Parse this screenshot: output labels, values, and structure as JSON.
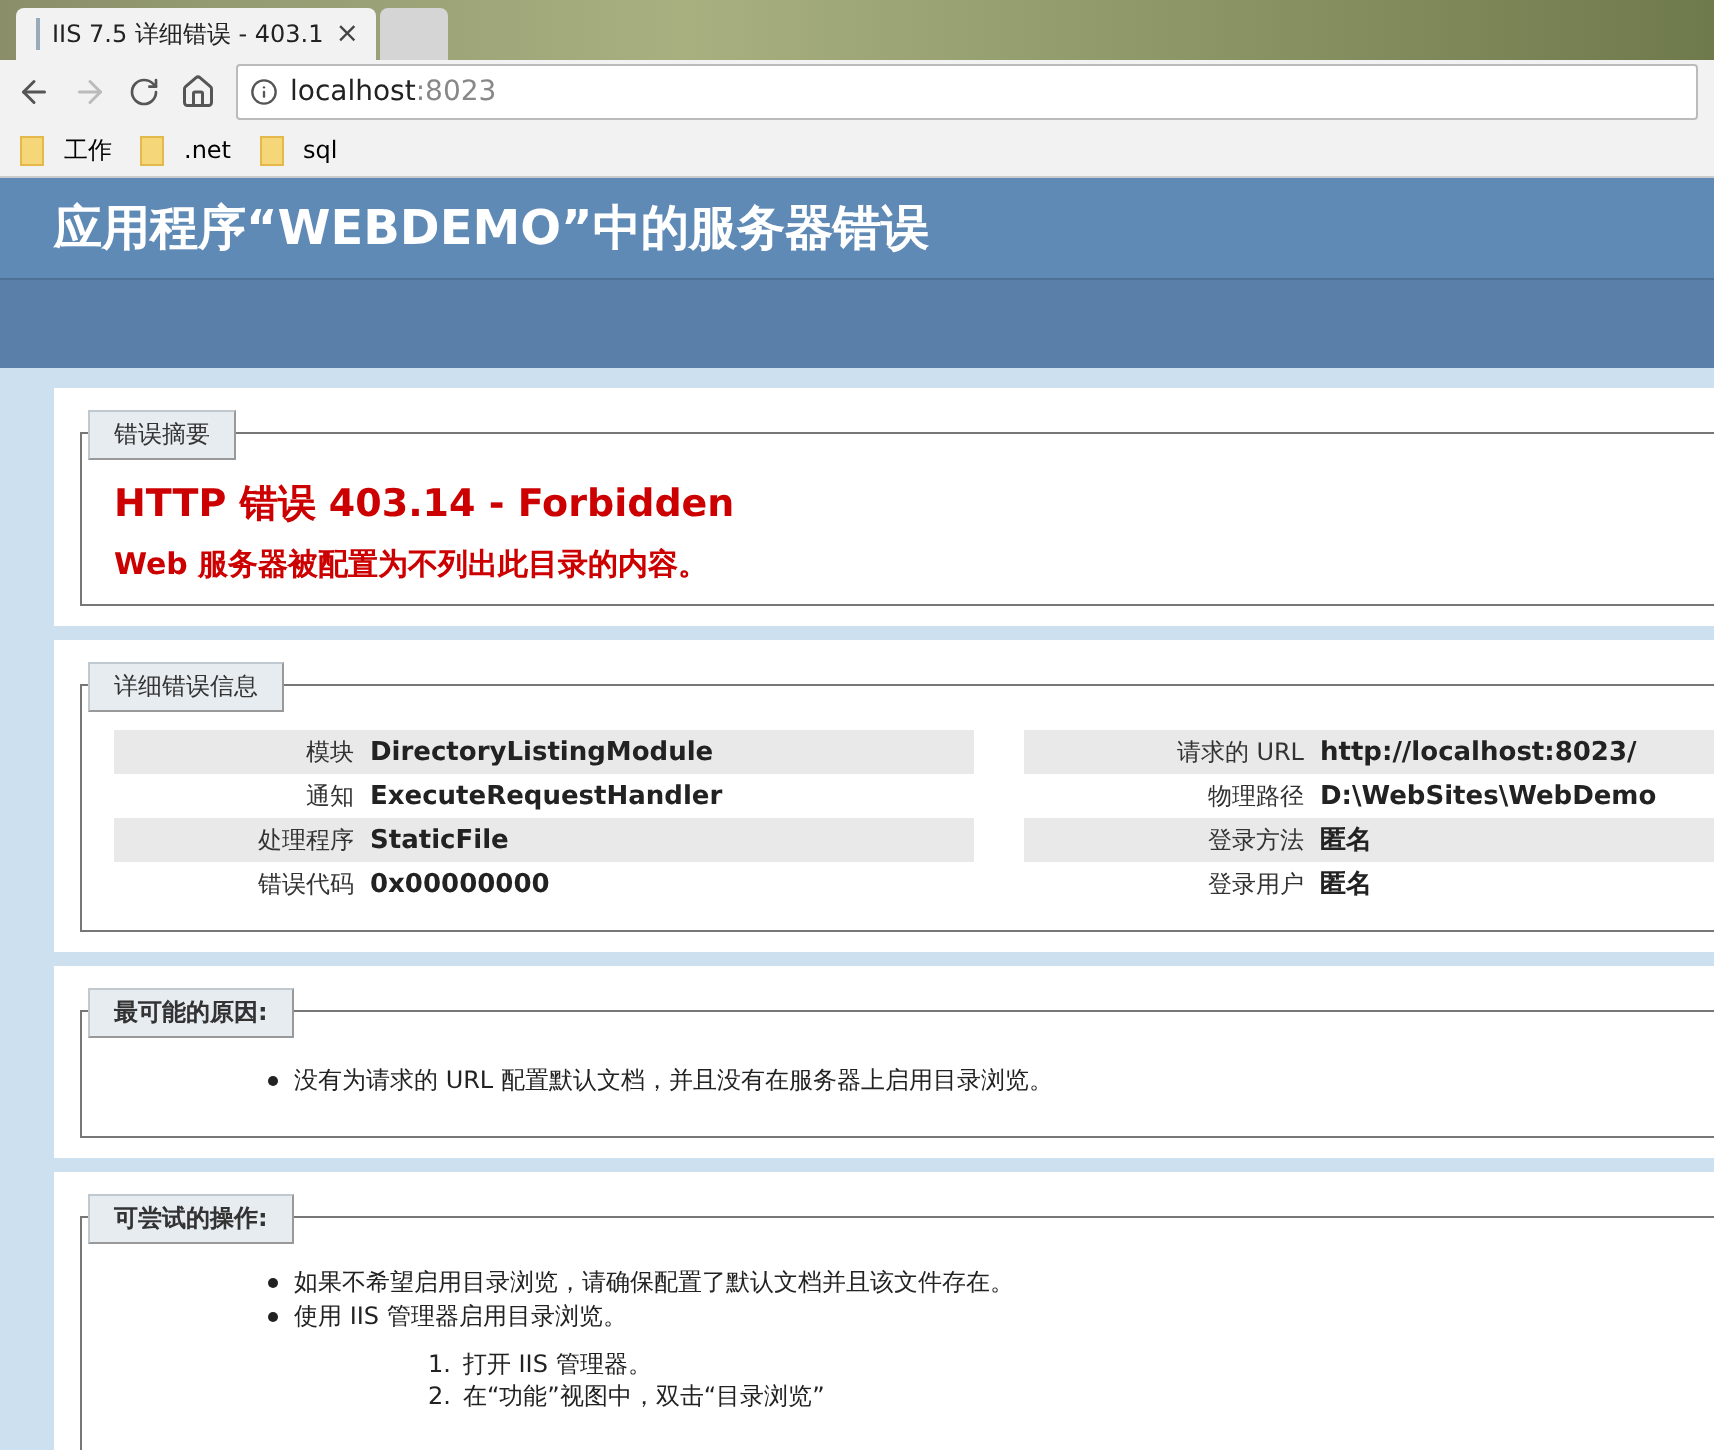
{
  "browser": {
    "tabs": [
      {
        "title": "IIS 7.5 详细错误 - 403.1",
        "selected": true,
        "close": "×"
      },
      {
        "selected": false
      }
    ],
    "address": {
      "host": "localhost",
      "port": ":8023"
    },
    "bookmarks": [
      {
        "label": "工作"
      },
      {
        "label": ".net"
      },
      {
        "label": "sql"
      }
    ]
  },
  "page": {
    "title": "应用程序“WEBDEMO”中的服务器错误",
    "summary": {
      "legend": "错误摘要",
      "heading": "HTTP 错误 403.14 - Forbidden",
      "message": "Web 服务器被配置为不列出此目录的内容。"
    },
    "details": {
      "legend": "详细错误信息",
      "left": [
        {
          "label": "模块",
          "value": "DirectoryListingModule"
        },
        {
          "label": "通知",
          "value": "ExecuteRequestHandler"
        },
        {
          "label": "处理程序",
          "value": "StaticFile"
        },
        {
          "label": "错误代码",
          "value": "0x00000000"
        }
      ],
      "right": [
        {
          "label": "请求的 URL",
          "value": "http://localhost:8023/"
        },
        {
          "label": "物理路径",
          "value": "D:\\WebSites\\WebDemo"
        },
        {
          "label": "登录方法",
          "value": "匿名"
        },
        {
          "label": "登录用户",
          "value": "匿名"
        }
      ]
    },
    "causes": {
      "legend": "最可能的原因:",
      "items": [
        {
          "text": "没有为请求的 URL 配置默认文档，并且没有在服务器上启用目录浏览。"
        }
      ]
    },
    "actions": {
      "legend": "可尝试的操作:",
      "items": [
        {
          "text": "如果不希望启用目录浏览，请确保配置了默认文档并且该文件存在。"
        },
        {
          "text": "使用 IIS 管理器启用目录浏览。",
          "steps": [
            {
              "number": "1.",
              "text": "打开 IIS 管理器。"
            },
            {
              "number": "2.",
              "text": "在“功能”视图中，双击“目录浏览”"
            }
          ]
        }
      ]
    }
  }
}
